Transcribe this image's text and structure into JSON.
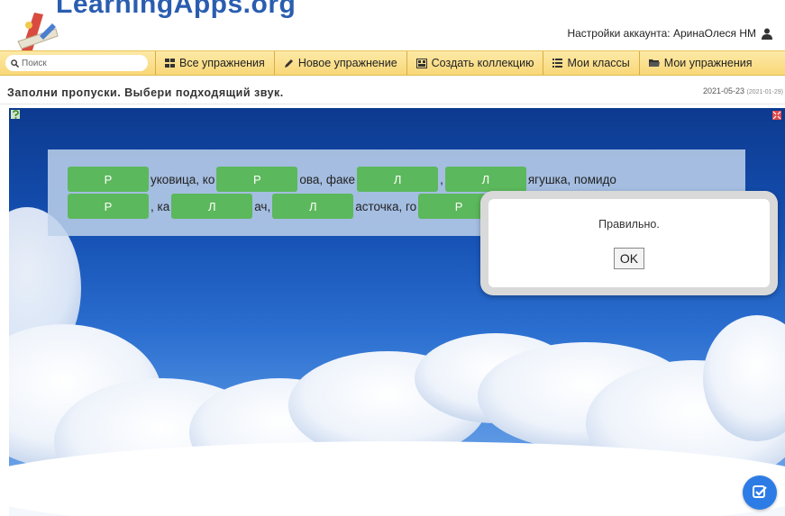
{
  "header": {
    "logo_text": "LearningApps.org",
    "account_label": "Настройки аккаунта: АринаОлеся НМ"
  },
  "search": {
    "placeholder": "Поиск",
    "icon": "search-icon"
  },
  "nav": {
    "items": [
      {
        "label": "Все упражнения",
        "icon": "grid-icon"
      },
      {
        "label": "Новое упражнение",
        "icon": "pencil-icon"
      },
      {
        "label": "Создать коллекцию",
        "icon": "collection-icon"
      },
      {
        "label": "Мои классы",
        "icon": "list-icon"
      },
      {
        "label": "Мои упражнения",
        "icon": "folder-icon"
      }
    ]
  },
  "page": {
    "title": "Заполни пропуски. Выбери подходящий звук.",
    "date": "2021-05-23",
    "date_sub": "(2021-01-29)"
  },
  "exercise": {
    "line1": [
      {
        "gap": "Р"
      },
      {
        "text": "уковица, ко"
      },
      {
        "gap": "Р"
      },
      {
        "text": "ова, факе"
      },
      {
        "gap": "Л"
      },
      {
        "text": ","
      },
      {
        "gap": "Л"
      },
      {
        "text": "ягушка, помидо"
      }
    ],
    "line2": [
      {
        "gap": "Р"
      },
      {
        "text": ", ка"
      },
      {
        "gap": "Л"
      },
      {
        "text": "ач,"
      },
      {
        "gap": "Л"
      },
      {
        "text": "асточка, го"
      },
      {
        "gap": "Р"
      }
    ]
  },
  "dialog": {
    "message": "Правильно.",
    "ok_label": "OK"
  },
  "colors": {
    "nav_bg": "#f8d778",
    "gap_green": "#5cb85c",
    "check_button": "#2d7ce6",
    "sky_dark": "#0d3a8f"
  }
}
